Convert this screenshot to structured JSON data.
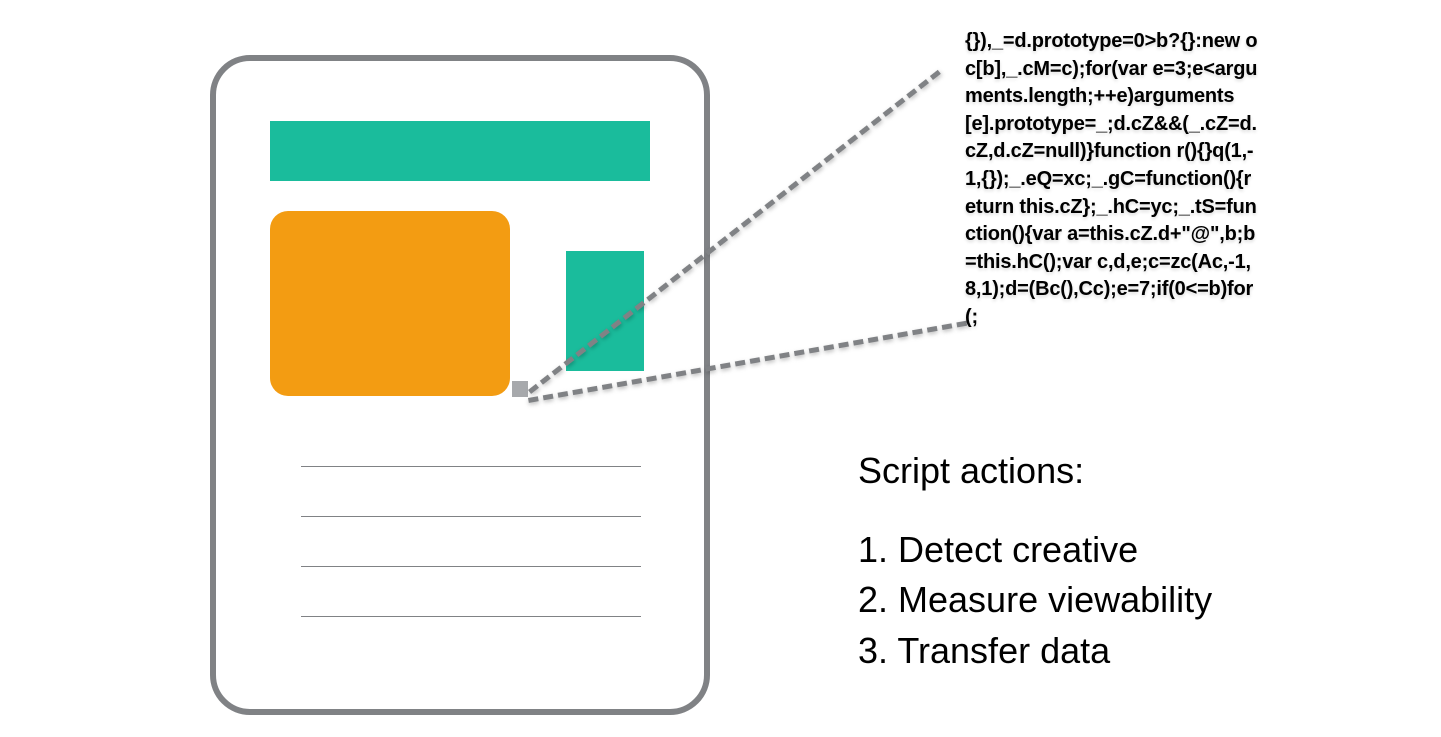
{
  "code_snippet": "{}),_=d.prototype=0>b?{}:new oc[b],_.cM=c);for(var e=3;e<arguments.length;++e)arguments[e].prototype=_;d.cZ&&(_.cZ=d.cZ,d.cZ=null)}function r(){}q(1,-1,{});_.eQ=xc;_.gC=function(){return this.cZ};_.hC=yc;_.tS=function(){var a=this.cZ.d+\"@\",b;b=this.hC();var c,d,e;c=zc(Ac,-1,8,1);d=(Bc(),Cc);e=7;if(0<=b)for(;",
  "actions": {
    "heading": "Script actions:",
    "items": [
      "1. Detect creative",
      "2. Measure viewability",
      "3. Transfer data"
    ]
  },
  "colors": {
    "frame": "#808285",
    "teal": "#1abc9c",
    "orange": "#f39c12",
    "gray_pixel": "#a7a9ac"
  }
}
